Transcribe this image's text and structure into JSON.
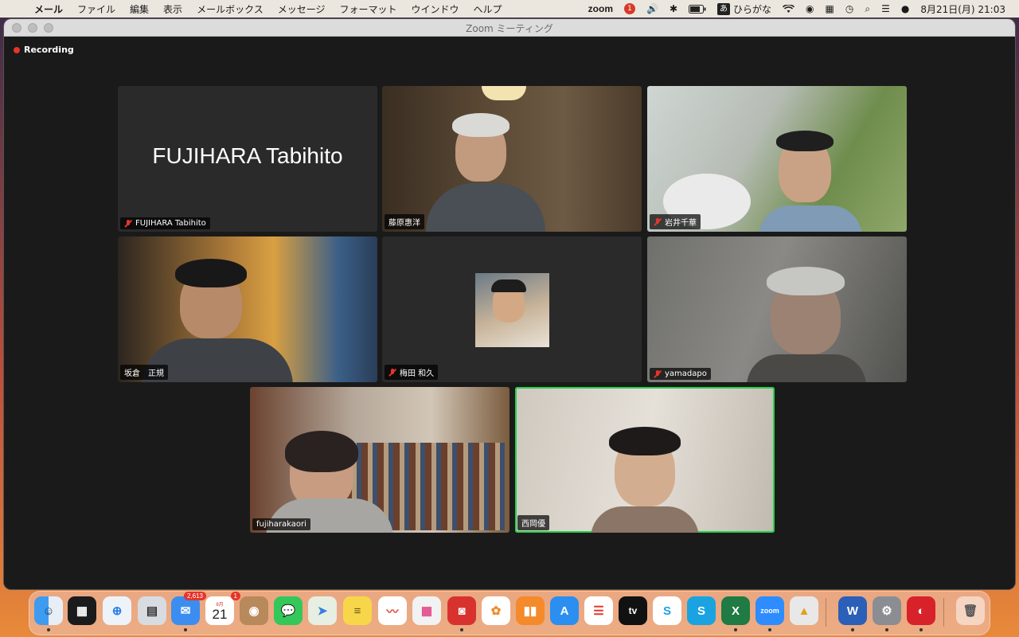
{
  "menubar": {
    "app_name": "メール",
    "menus": [
      "ファイル",
      "編集",
      "表示",
      "メールボックス",
      "メッセージ",
      "フォーマット",
      "ウインドウ",
      "ヘルプ"
    ],
    "zoom_brand": "zoom",
    "dropbox_badge": "1",
    "ime_box": "あ",
    "ime_label": "ひらがな",
    "datetime": "8月21日(月) 21:03"
  },
  "window": {
    "title": "Zoom ミーティング",
    "recording_label": "Recording"
  },
  "participants": [
    {
      "name": "FUJIHARA Tabihito",
      "display": "FUJIHARA Tabihito",
      "muted": true
    },
    {
      "name": "藤原惠洋",
      "muted": false
    },
    {
      "name": "岩井千華",
      "muted": true
    },
    {
      "name": "坂倉　正規",
      "muted": false
    },
    {
      "name": "梅田 和久",
      "muted": true
    },
    {
      "name": "yamadapo",
      "muted": true
    },
    {
      "name": "fujiharakaori",
      "muted": false
    },
    {
      "name": "西岡優",
      "muted": false,
      "active_speaker": true
    }
  ],
  "dock": {
    "mail_badge": "2,613",
    "calendar_month": "8月",
    "calendar_day": "21",
    "calendar_badge": "1",
    "tv_label": "tv",
    "zoom_label": "zoom",
    "word_label": "W",
    "excel_label": "X",
    "skype_label": "S"
  }
}
